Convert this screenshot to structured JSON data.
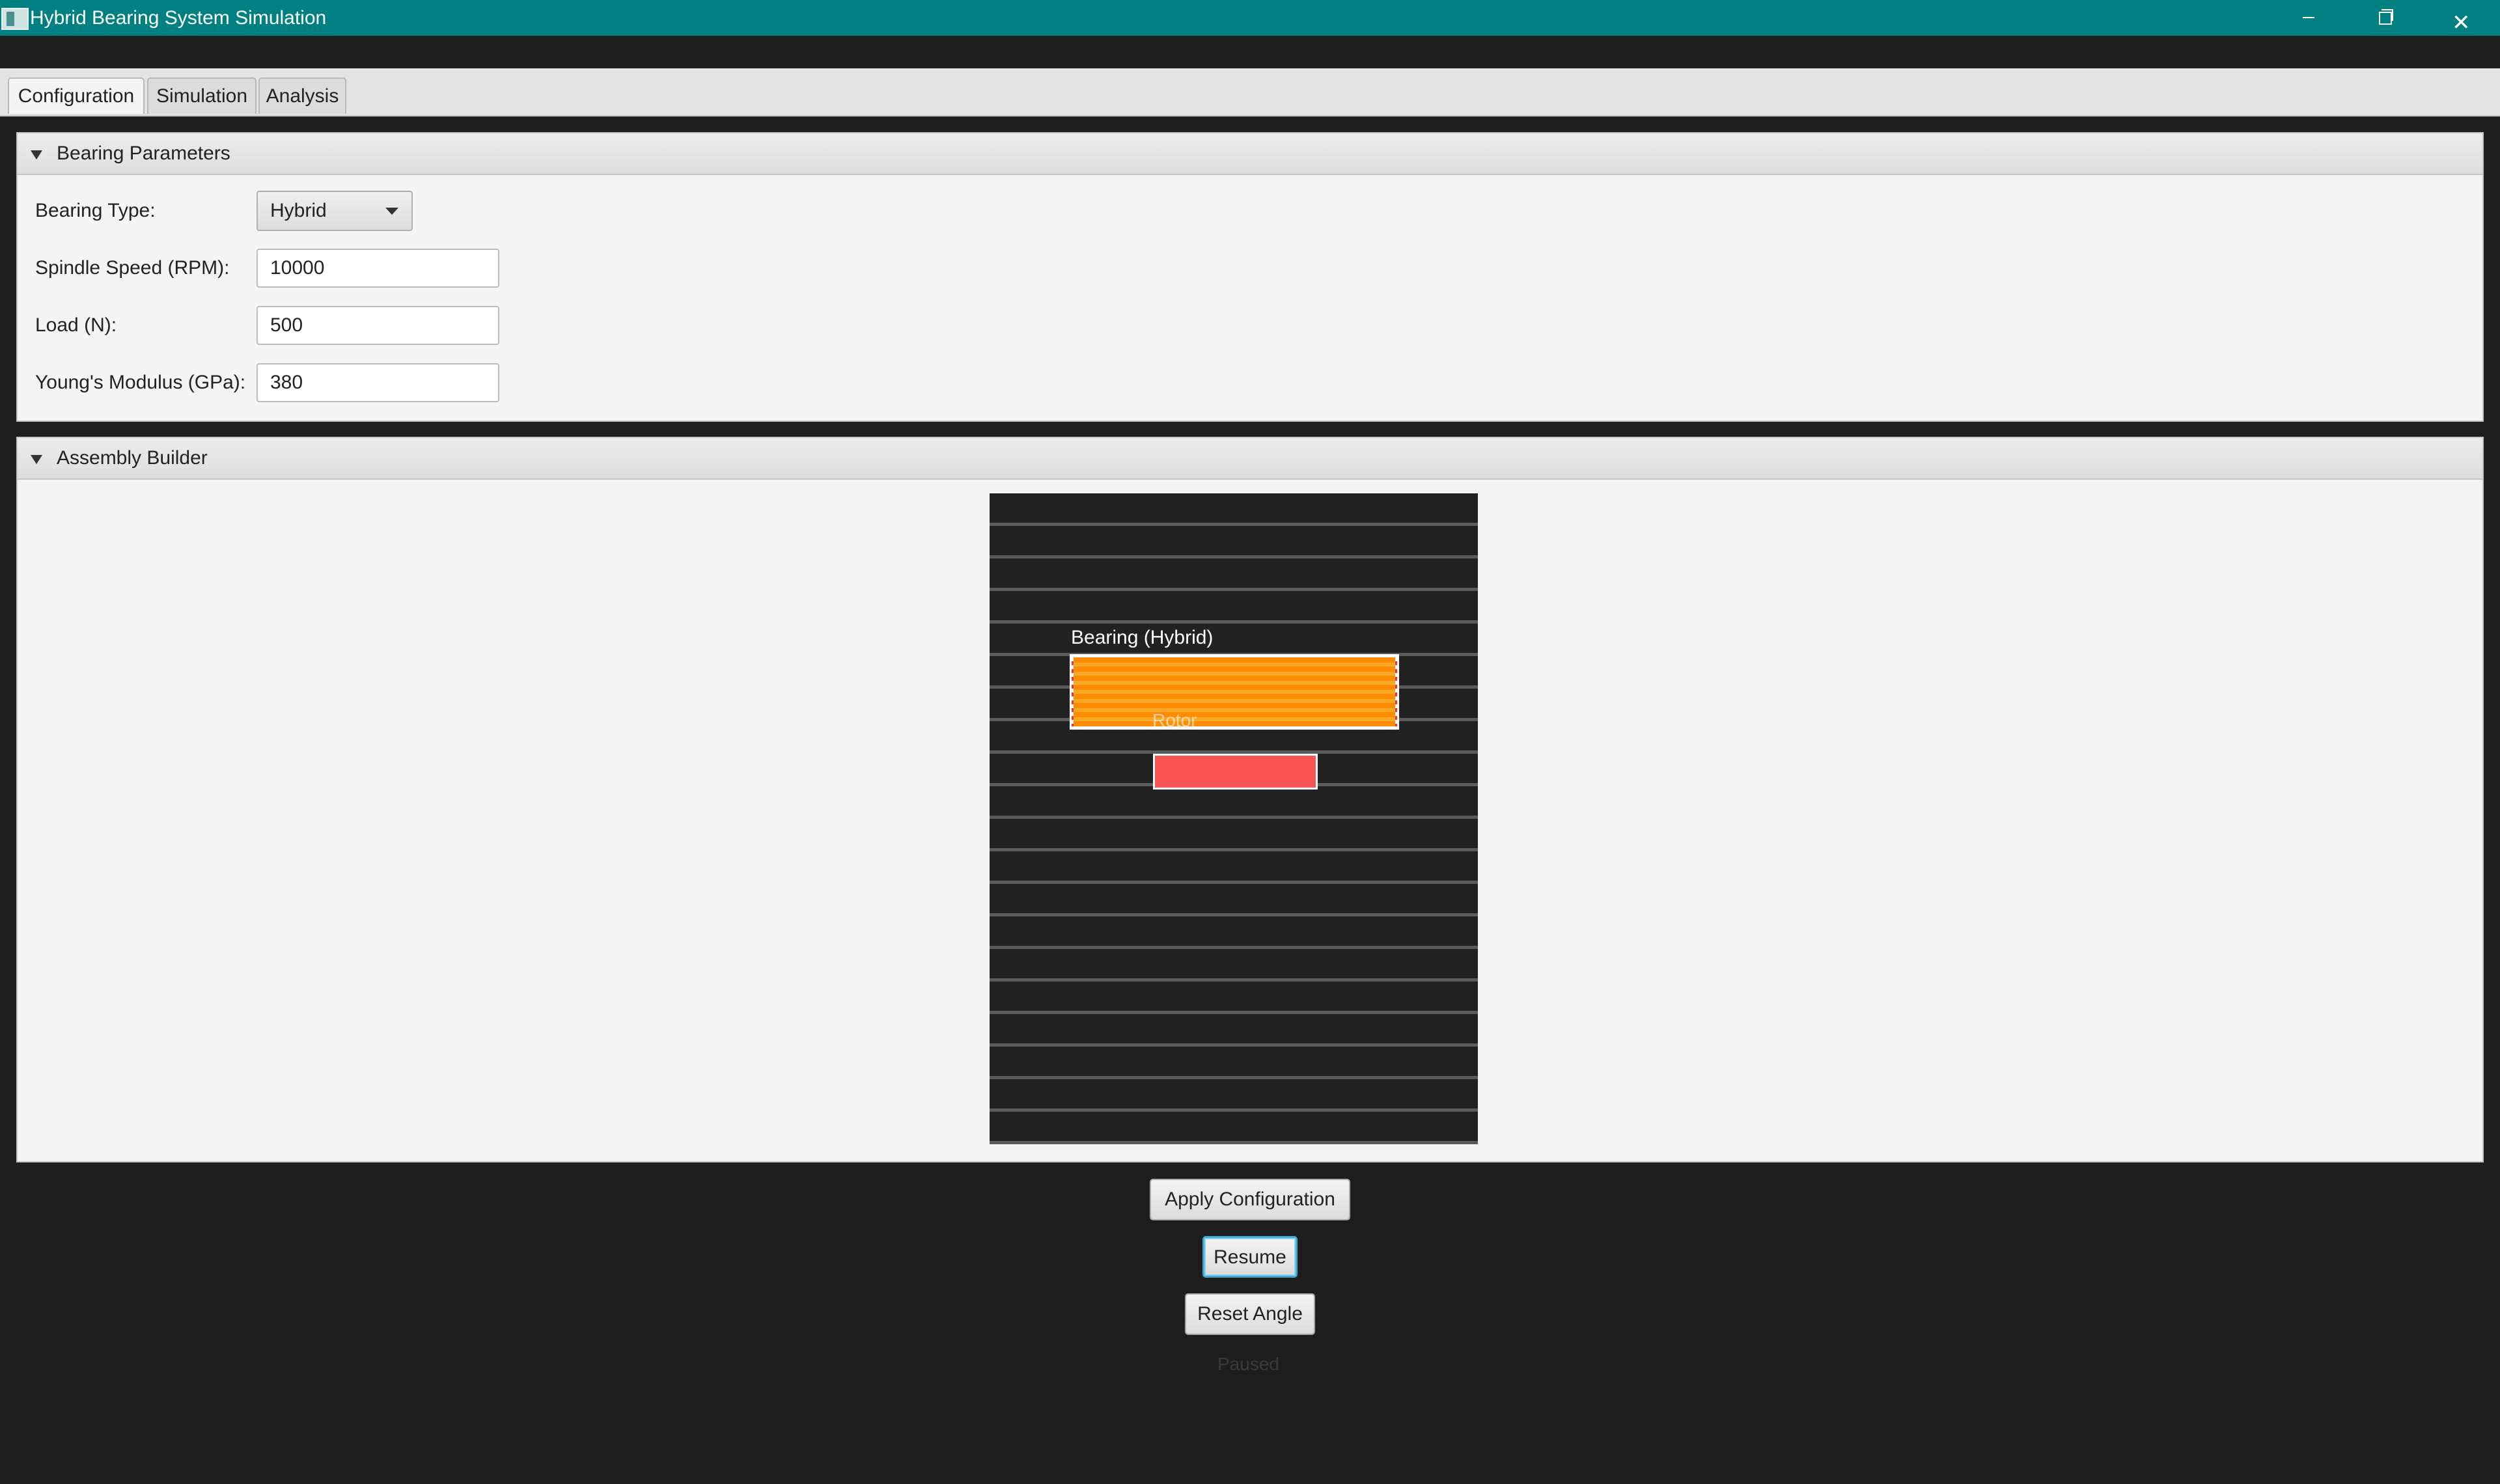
{
  "window": {
    "title": "Hybrid Bearing System Simulation",
    "controls": [
      "minimize",
      "restore",
      "close"
    ]
  },
  "tabs": [
    {
      "label": "Configuration",
      "active": true
    },
    {
      "label": "Simulation",
      "active": false
    },
    {
      "label": "Analysis",
      "active": false
    }
  ],
  "bearing_parameters": {
    "header": "Bearing Parameters",
    "bearing_type_label": "Bearing Type:",
    "bearing_type_value": "Hybrid",
    "spindle_speed_label": "Spindle Speed (RPM):",
    "spindle_speed_value": "10000",
    "load_label": "Load (N):",
    "load_value": "500",
    "youngs_modulus_label": "Young's Modulus (GPa):",
    "youngs_modulus_value": "380"
  },
  "assembly_builder": {
    "header": "Assembly Builder",
    "bearing_label": "Bearing (Hybrid)",
    "rotor_label": "Rotor",
    "colors": {
      "canvas_bg": "#222222",
      "gridline": "#5b5b5b",
      "bearing_fill": "#ff8c00",
      "bearing_stripe": "#f9a826",
      "rotor_fill": "#f95555"
    }
  },
  "actions": {
    "apply_label": "Apply Configuration",
    "resume_label": "Resume",
    "reset_label": "Reset Angle",
    "status_text": "Paused"
  }
}
